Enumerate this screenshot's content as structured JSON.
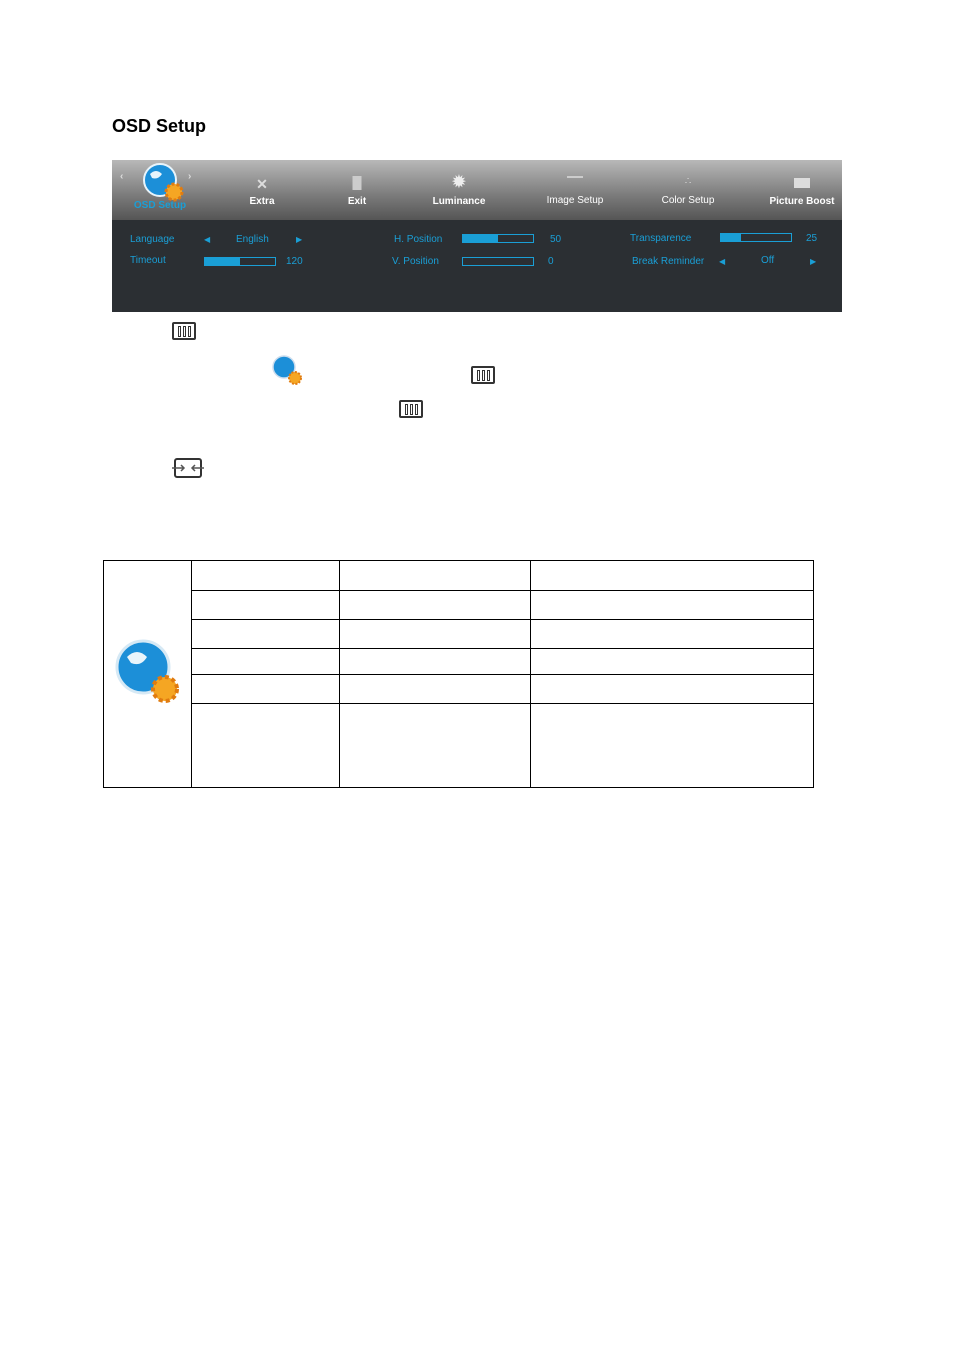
{
  "heading": "OSD Setup",
  "osd": {
    "tabs": [
      {
        "label": "OSD Setup",
        "icon": "globe-gear-icon",
        "active": true
      },
      {
        "label": "Extra",
        "icon": "tools-icon"
      },
      {
        "label": "Exit",
        "icon": "exit-door-icon"
      },
      {
        "label": "Luminance",
        "icon": "sun-icon"
      },
      {
        "label": "Image Setup",
        "icon": "image-setup-icon"
      },
      {
        "label": "Color Setup",
        "icon": "color-dots-icon"
      },
      {
        "label": "Picture Boost",
        "icon": "picture-boost-icon"
      }
    ],
    "settings": {
      "language": {
        "label": "Language",
        "value": "English"
      },
      "timeout": {
        "label": "Timeout",
        "value": "120",
        "level": 0.5
      },
      "h_position": {
        "label": "H. Position",
        "value": "50",
        "level": 0.5
      },
      "v_position": {
        "label": "V. Position",
        "value": "0",
        "level": 0
      },
      "transparence": {
        "label": "Transparence",
        "value": "25",
        "level": 0.25
      },
      "break_reminder": {
        "label": "Break Reminder",
        "value": "Off"
      }
    },
    "accent": "#1a9fd6"
  }
}
